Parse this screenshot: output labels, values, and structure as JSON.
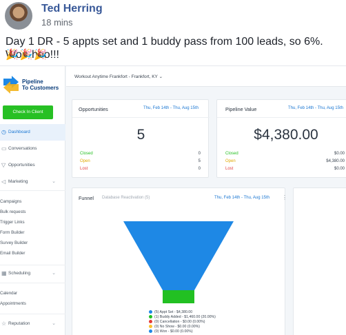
{
  "post": {
    "author": "Ted Herring",
    "time": "18 mins",
    "text": "Day 1 DR - 5 appts set and 1 buddy pass from 100 leads, so 6%. Woo-hoo!!!",
    "emojis": "🎉🎉🎉"
  },
  "app": {
    "logo_line1": "Pipeline",
    "logo_line2": "To Customers",
    "checkin_label": "Check In Client",
    "location": "Workout Anytime Frankfort - Frankfort, KY",
    "nav": {
      "dashboard": "Dashboard",
      "conversations": "Conversations",
      "opportunities": "Opportunities",
      "marketing": "Marketing",
      "scheduling": "Scheduling",
      "reputation": "Reputation"
    },
    "marketing_sub": [
      "Campaigns",
      "Bulk requests",
      "Trigger Links",
      "Form Builder",
      "Survey Builder",
      "Email Builder"
    ],
    "scheduling_sub": [
      "Calendar",
      "Appointments"
    ]
  },
  "opportunities": {
    "title": "Opportunities",
    "date_range": "Thu, Feb 14th - Thu, Aug 15th",
    "total": "5",
    "rows": [
      {
        "label": "Closed",
        "value": "0"
      },
      {
        "label": "Open",
        "value": "5"
      },
      {
        "label": "Lost",
        "value": "0"
      }
    ]
  },
  "pipeline_value": {
    "title": "Pipeline Value",
    "date_range": "Thu, Feb 14th - Thu, Aug 15th",
    "total": "$4,380.00",
    "rows": [
      {
        "label": "Closed",
        "value": "$0.00"
      },
      {
        "label": "Open",
        "value": "$4,380.00"
      },
      {
        "label": "Lost",
        "value": "$0.00"
      }
    ]
  },
  "funnel": {
    "title": "Funnel",
    "subtitle": "Database Reactivation (5)",
    "date_range": "Thu, Feb 14th - Thu, Aug 15th",
    "legend": [
      {
        "text": "(5) Appt Set - $4,380.00",
        "color": "#1e88e5"
      },
      {
        "text": "(1) Buddy Added - $1,460.00 (20.00%)",
        "color": "#22c022"
      },
      {
        "text": "(0) Cancellation - $0.00 (0.00%)",
        "color": "#e53935"
      },
      {
        "text": "(0) No Show - $0.00 (0.00%)",
        "color": "#fbc02d"
      },
      {
        "text": "(0) Won - $0.00 (0.00%)",
        "color": "#1e88e5"
      }
    ]
  },
  "colors": {
    "funnel_blue": "#1e88e5",
    "funnel_green": "#22c022",
    "accent": "#1976d2",
    "checkin_green": "#27c024"
  }
}
